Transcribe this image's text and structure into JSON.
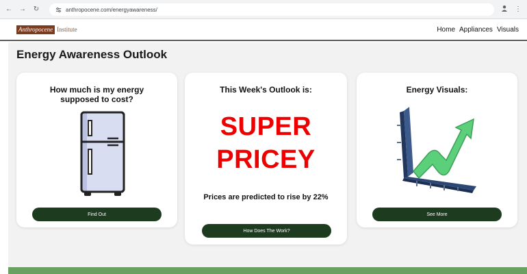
{
  "browser": {
    "url": "anthropocene.com/energyawareness/"
  },
  "site": {
    "logo_main": "Anthropocene",
    "logo_sub": "Institute",
    "nav": [
      "Home",
      "Appliances",
      "Visuals"
    ]
  },
  "page": {
    "title": "Energy Awareness Outlook"
  },
  "cards": {
    "cost": {
      "title_line1": "How much is my energy",
      "title_line2": "supposed to cost?",
      "button": "Find Out",
      "icon": "fridge-icon"
    },
    "outlook": {
      "title": "This Week's Outlook is:",
      "value_line1": "SUPER",
      "value_line2": "PRICEY",
      "prediction": "Prices are predicted to rise by 22%",
      "button": "How Does The Work?",
      "value_color": "#ee0000"
    },
    "visuals": {
      "title": "Energy Visuals:",
      "button": "See More",
      "icon": "rising-chart-icon"
    }
  },
  "colors": {
    "button_bg": "#1d3b1f",
    "footer_band": "#6aa060",
    "logo_bg": "#7a3b1e"
  }
}
